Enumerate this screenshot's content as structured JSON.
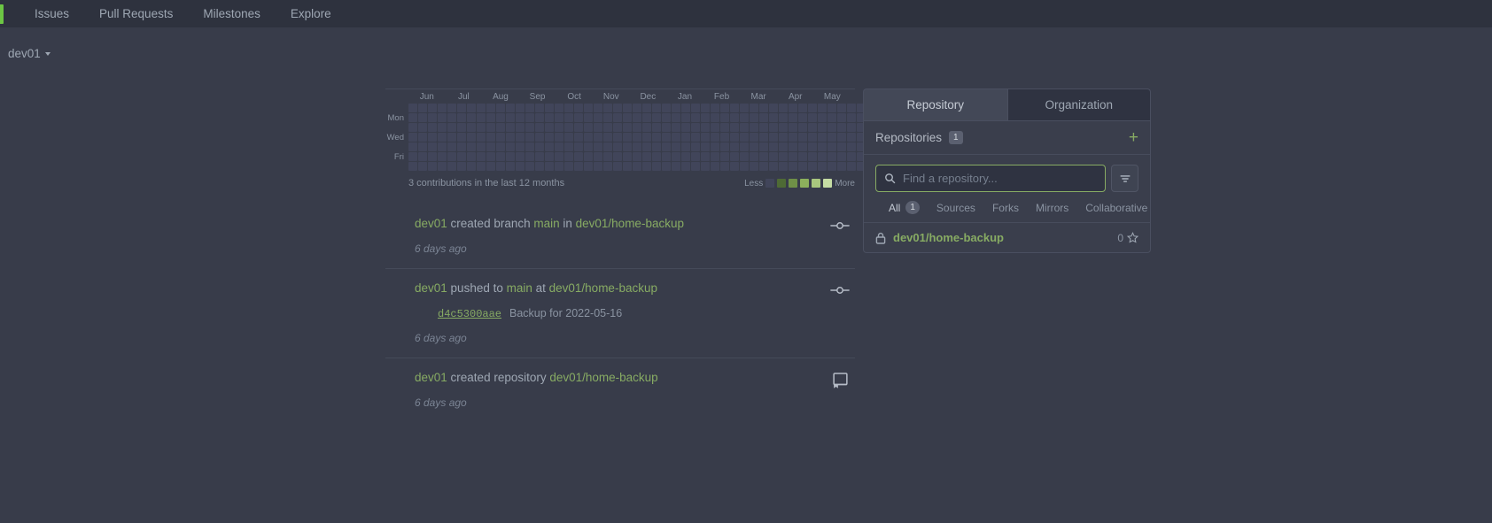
{
  "navbar": {
    "logo_icon": "gitea-logo-icon",
    "links": [
      {
        "label": "Issues"
      },
      {
        "label": "Pull Requests"
      },
      {
        "label": "Milestones"
      },
      {
        "label": "Explore"
      }
    ]
  },
  "subbar": {
    "user": "dev01",
    "caret_icon": "chevron-down-icon"
  },
  "heatmap": {
    "months": [
      "Jun",
      "Jul",
      "Aug",
      "Sep",
      "Oct",
      "Nov",
      "Dec",
      "Jan",
      "Feb",
      "Mar",
      "Apr",
      "May"
    ],
    "day_labels": [
      "Mon",
      "Wed",
      "Fri"
    ],
    "summary": "3 contributions in the last 12 months",
    "legend_less": "Less",
    "legend_more": "More",
    "columns": 53,
    "rows": 7,
    "empty_color": "#41455a",
    "legend_colors": [
      "#41455a",
      "#4e6a35",
      "#6f9047",
      "#8cb05c",
      "#a9c77e",
      "#c6dda4"
    ],
    "active_cells": [
      {
        "column": 51,
        "row": 1,
        "color": "#a9c77e",
        "count": 3
      }
    ]
  },
  "feed": [
    {
      "icon": "commit-icon",
      "actor": "dev01",
      "action_pre": " created branch ",
      "target": "main",
      "action_mid": " in ",
      "repo": "dev01/home-backup",
      "commit_sha": "",
      "commit_message": "",
      "time": "6 days ago"
    },
    {
      "icon": "commit-icon",
      "actor": "dev01",
      "action_pre": " pushed to ",
      "target": "main",
      "action_mid": " at ",
      "repo": "dev01/home-backup",
      "commit_sha": "d4c5300aae",
      "commit_message": "Backup for 2022-05-16",
      "time": "6 days ago"
    },
    {
      "icon": "repo-icon",
      "actor": "dev01",
      "action_pre": " created repository ",
      "target": "",
      "action_mid": "",
      "repo": "dev01/home-backup",
      "commit_sha": "",
      "commit_message": "",
      "time": "6 days ago"
    }
  ],
  "sidebar": {
    "tabs": [
      {
        "label": "Repository",
        "active": true
      },
      {
        "label": "Organization",
        "active": false
      }
    ],
    "panel_title": "Repositories",
    "panel_count": "1",
    "add_label": "+",
    "search": {
      "placeholder": "Find a repository...",
      "value": "",
      "search_icon": "search-icon",
      "filter_icon": "filter-icon"
    },
    "filters": [
      {
        "label": "All",
        "count": "1",
        "active": true
      },
      {
        "label": "Sources",
        "count": "",
        "active": false
      },
      {
        "label": "Forks",
        "count": "",
        "active": false
      },
      {
        "label": "Mirrors",
        "count": "",
        "active": false
      },
      {
        "label": "Collaborative",
        "count": "",
        "active": false
      }
    ],
    "repos": [
      {
        "name": "dev01/home-backup",
        "private": true,
        "stars": "0",
        "lock_icon": "lock-icon",
        "star_icon": "star-icon"
      }
    ]
  }
}
